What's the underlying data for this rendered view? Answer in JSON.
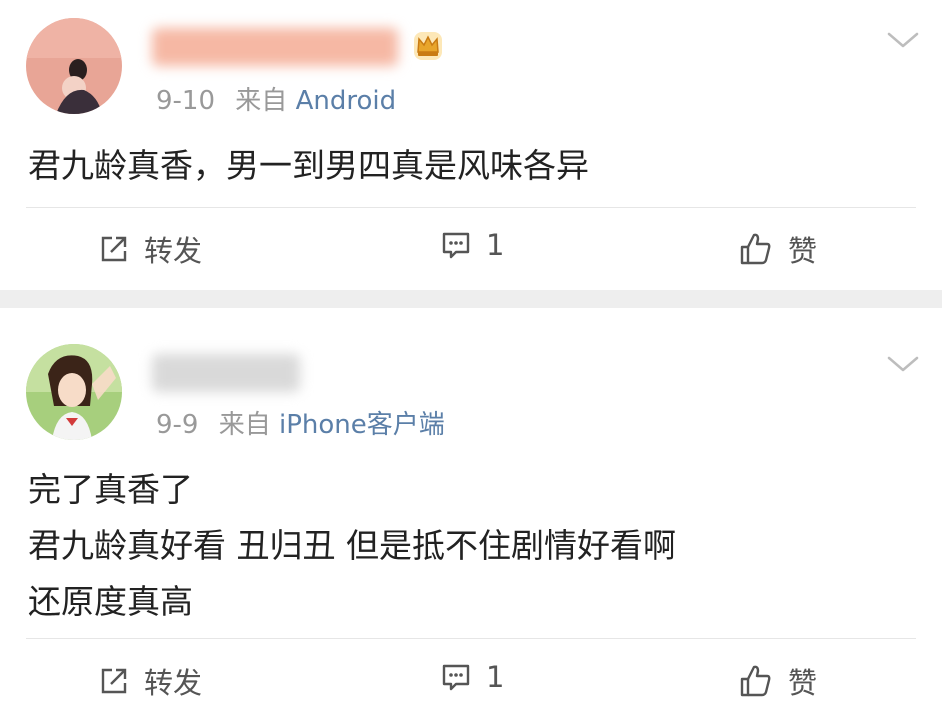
{
  "posts": [
    {
      "date": "9-10",
      "source_prefix": "来自",
      "source": "Android",
      "content_lines": [
        "君九龄真香，男一到男四真是风味各异"
      ],
      "actions": {
        "repost_label": "转发",
        "comment_count": "1",
        "like_label": "赞"
      },
      "colors": {
        "name_blur": "#f6b8a4",
        "avatar_bg": "#e8a596"
      }
    },
    {
      "date": "9-9",
      "source_prefix": "来自",
      "source": "iPhone客户端",
      "content_lines": [
        "完了真香了",
        "君九龄真好看 丑归丑 但是抵不住剧情好看啊",
        "还原度真高"
      ],
      "actions": {
        "repost_label": "转发",
        "comment_count": "1",
        "like_label": "赞"
      },
      "colors": {
        "name_blur": "#d9d9d9",
        "avatar_bg": "#a7cf7d"
      }
    }
  ],
  "colors": {
    "separator": "#eeeeee",
    "source_link": "#5b7fa8",
    "meta_text": "#999999",
    "crown": "#e8a52b"
  },
  "icons": [
    "crown-icon",
    "chevron-down-icon",
    "repost-icon",
    "comment-icon",
    "thumbs-up-icon"
  ]
}
